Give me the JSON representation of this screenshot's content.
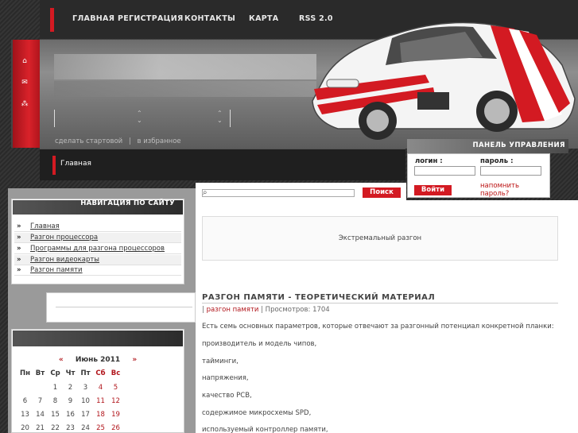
{
  "topnav": {
    "items": [
      "ГЛАВНАЯ",
      "РЕГИСТРАЦИЯ",
      "КОНТАКТЫ",
      "КАРТА",
      "RSS 2.0"
    ]
  },
  "header": {
    "set_home": "сделать стартовой",
    "separator": "|",
    "favorites": "в избранное"
  },
  "left_icons": [
    "home-icon",
    "mail-icon",
    "sitemap-icon"
  ],
  "breadcrumb": "Главная",
  "control_panel": {
    "title": "ПАНЕЛЬ УПРАВЛЕНИЯ",
    "login_label": "логин :",
    "password_label": "пароль :",
    "login_button": "Войти",
    "remind_link": "напомнить пароль?"
  },
  "search": {
    "button": "Поиск"
  },
  "banner": "Экстремальный разгон",
  "article": {
    "title": "РАЗГОН ПАМЯТИ - ТЕОРЕТИЧЕСКИЙ МАТЕРИАЛ",
    "meta_prefix": "|",
    "category": "разгон памяти",
    "views": "| Просмотров: 1704",
    "paragraphs": [
      "Есть семь основных параметров, которые отвечают за разгонный потенциал конкретной планки:",
      "производитель и модель чипов,",
      "тайминги,",
      "напряжения,",
      "качество PCB,",
      "содержимое микросхемы SPD,",
      "используемый контроллер памяти,"
    ]
  },
  "navigation": {
    "title": "НАВИГАЦИЯ ПО САЙТУ",
    "bullet": "»",
    "items": [
      "Главная",
      "Разгон процессора",
      "Программы для разгона процессоров",
      "Разгон видеокарты",
      "Разгон памяти"
    ]
  },
  "calendar": {
    "prev": "«",
    "month": "Июнь 2011",
    "next": "»",
    "weekdays": [
      "Пн",
      "Вт",
      "Ср",
      "Чт",
      "Пт",
      "Сб",
      "Вс"
    ],
    "rows": [
      [
        "",
        "",
        "1",
        "2",
        "3",
        "4",
        "5"
      ],
      [
        "6",
        "7",
        "8",
        "9",
        "10",
        "11",
        "12"
      ],
      [
        "13",
        "14",
        "15",
        "16",
        "17",
        "18",
        "19"
      ],
      [
        "20",
        "21",
        "22",
        "23",
        "24",
        "25",
        "26"
      ]
    ]
  },
  "colors": {
    "accent": "#d31a22",
    "link": "#b1151b"
  }
}
